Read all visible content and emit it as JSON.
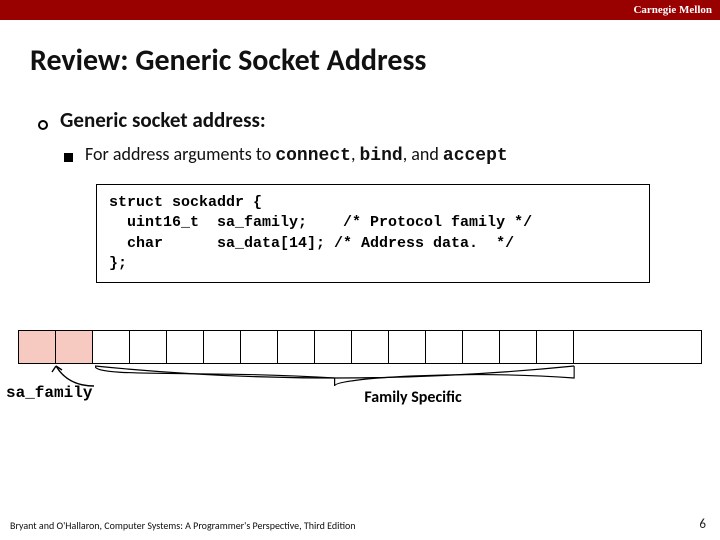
{
  "header": {
    "org": "Carnegie Mellon"
  },
  "title": "Review: Generic Socket Address",
  "bullets": {
    "lvl1": "Generic socket address:",
    "lvl2_prefix": "For address arguments to ",
    "fn1": "connect",
    "sep1": ", ",
    "fn2": "bind",
    "sep2": ", and ",
    "fn3": "accept"
  },
  "code": "struct sockaddr {\n  uint16_t  sa_family;    /* Protocol family */\n  char      sa_data[14]; /* Address data.  */\n};",
  "diagram": {
    "sa_family_label": "sa_family",
    "family_specific": "Family Specific"
  },
  "footer": "Bryant and O'Hallaron, Computer Systems: A Programmer's Perspective, Third Edition",
  "page": "6"
}
